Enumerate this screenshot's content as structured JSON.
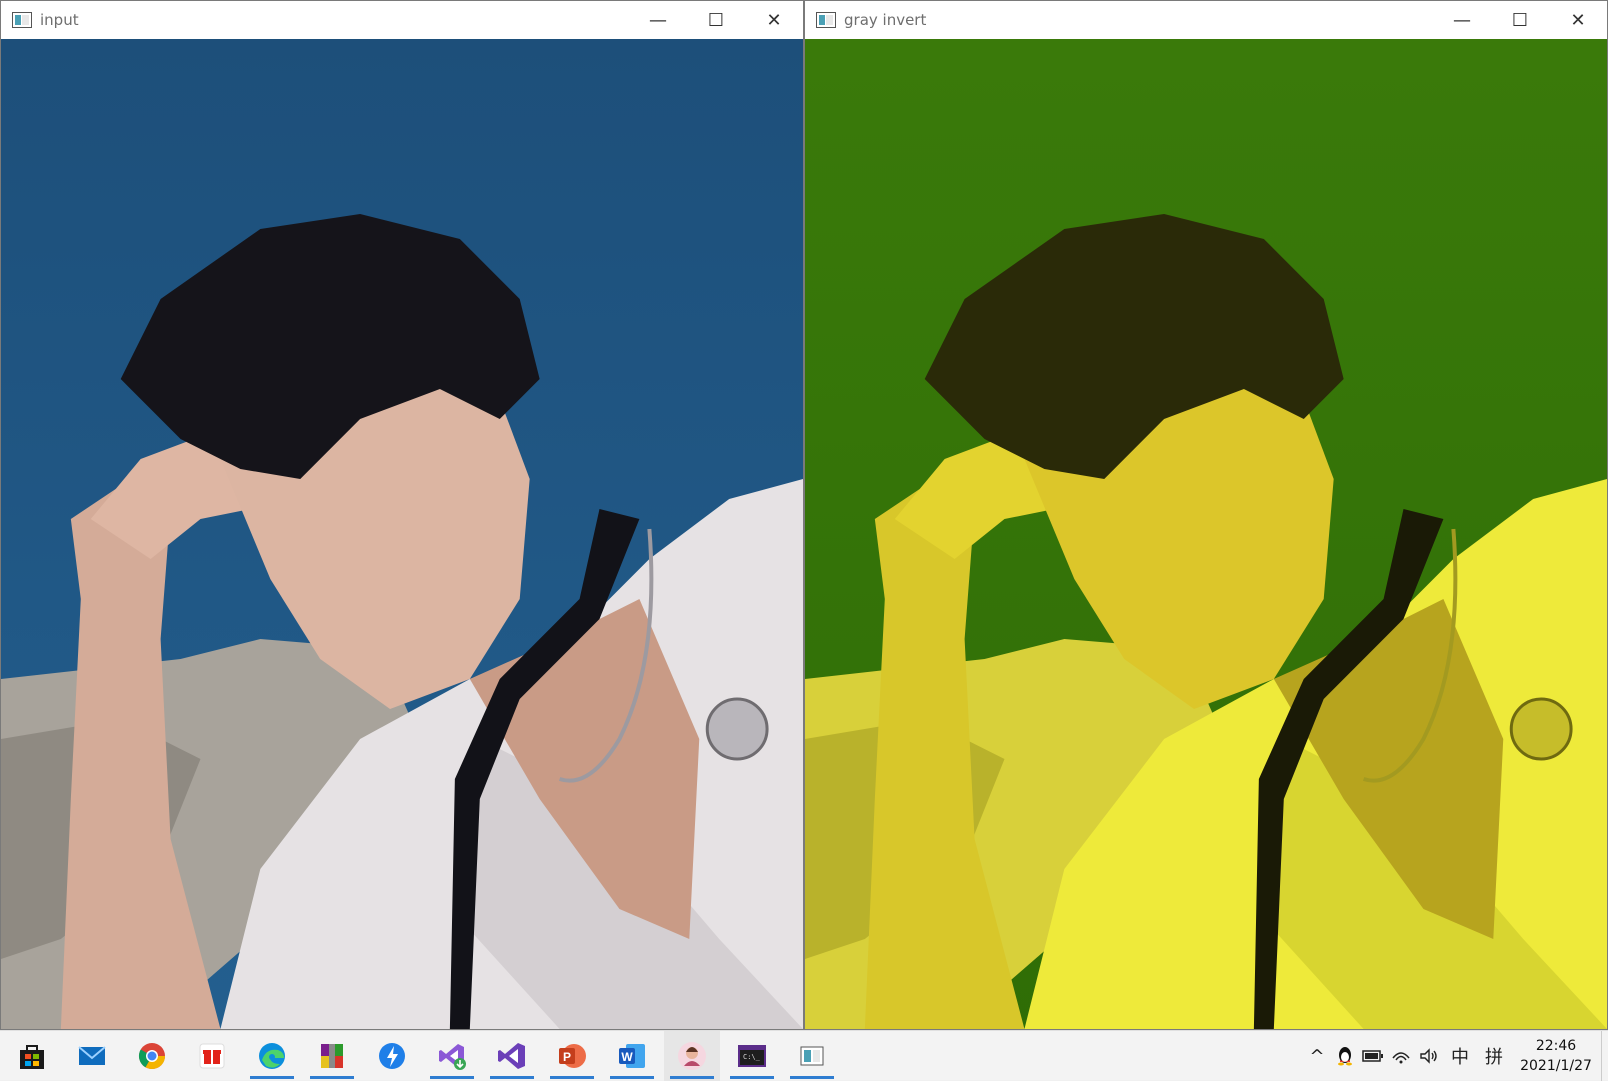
{
  "windows": [
    {
      "id": "input",
      "title": "input"
    },
    {
      "id": "gray",
      "title": "gray invert"
    }
  ],
  "title_buttons": {
    "minimize": "—",
    "maximize": "☐",
    "close": "✕"
  },
  "taskbar": {
    "apps": [
      {
        "name": "store-icon"
      },
      {
        "name": "mail-icon"
      },
      {
        "name": "chrome-icon"
      },
      {
        "name": "gift-icon"
      },
      {
        "name": "edge-icon"
      },
      {
        "name": "winrar-icon"
      },
      {
        "name": "thunder-icon"
      },
      {
        "name": "visual-studio-installer-icon"
      },
      {
        "name": "visual-studio-icon"
      },
      {
        "name": "powerpoint-icon"
      },
      {
        "name": "word-icon"
      },
      {
        "name": "avatar-app-icon"
      },
      {
        "name": "console-icon"
      },
      {
        "name": "opencv-window-icon"
      }
    ],
    "tray": {
      "chevron": "^",
      "ime_mode": "中",
      "ime_layout": "拼",
      "time": "22:46",
      "date": "2021/1/27"
    }
  },
  "colors": {
    "accent": "#2f7dd1",
    "input_sea": "#1f5a86",
    "invert_sea": "#3f7d0c",
    "invert_skin": "#e2d92a"
  }
}
